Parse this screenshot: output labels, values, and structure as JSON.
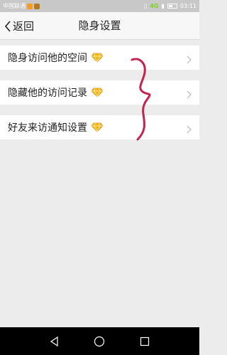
{
  "status_bar": {
    "carrier": "中国联通",
    "network": "4G",
    "time": "03:11"
  },
  "header": {
    "back_label": "返回",
    "title": "隐身设置"
  },
  "settings": [
    {
      "label": "隐身访问他的空间",
      "icon": "diamond-icon"
    },
    {
      "label": "隐藏他的访问记录",
      "icon": "diamond-icon"
    },
    {
      "label": "好友来访通知设置",
      "icon": "diamond-icon"
    }
  ],
  "colors": {
    "diamond": "#f4b71d",
    "annotation": "#c2244f",
    "chevron": "#b8b8b8"
  },
  "nav_bar": [
    "back-triangle-icon",
    "home-circle-icon",
    "recents-square-icon"
  ]
}
